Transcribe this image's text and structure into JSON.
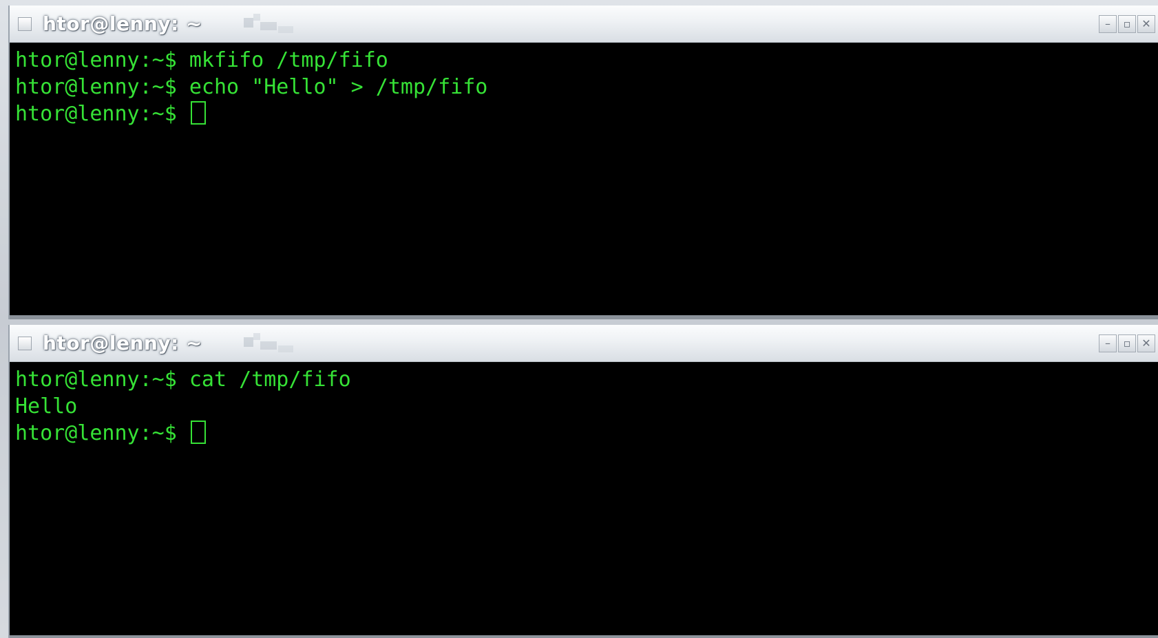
{
  "windows": [
    {
      "title": "htor@lenny: ~",
      "lines": [
        "htor@lenny:~$ mkfifo /tmp/fifo",
        "htor@lenny:~$ echo \"Hello\" > /tmp/fifo"
      ],
      "prompt": "htor@lenny:~$ "
    },
    {
      "title": "htor@lenny: ~",
      "lines": [
        "htor@lenny:~$ cat /tmp/fifo",
        "Hello"
      ],
      "prompt": "htor@lenny:~$ "
    }
  ],
  "wm_buttons": {
    "minimize": "–",
    "maximize": "▫",
    "close": "✕"
  },
  "colors": {
    "terminal_bg": "#000000",
    "terminal_fg": "#36e236",
    "titlebar": "#eef1f4"
  },
  "icons": [
    "window-menu-icon",
    "minimize-icon",
    "maximize-icon",
    "close-icon",
    "cursor-block-icon"
  ]
}
